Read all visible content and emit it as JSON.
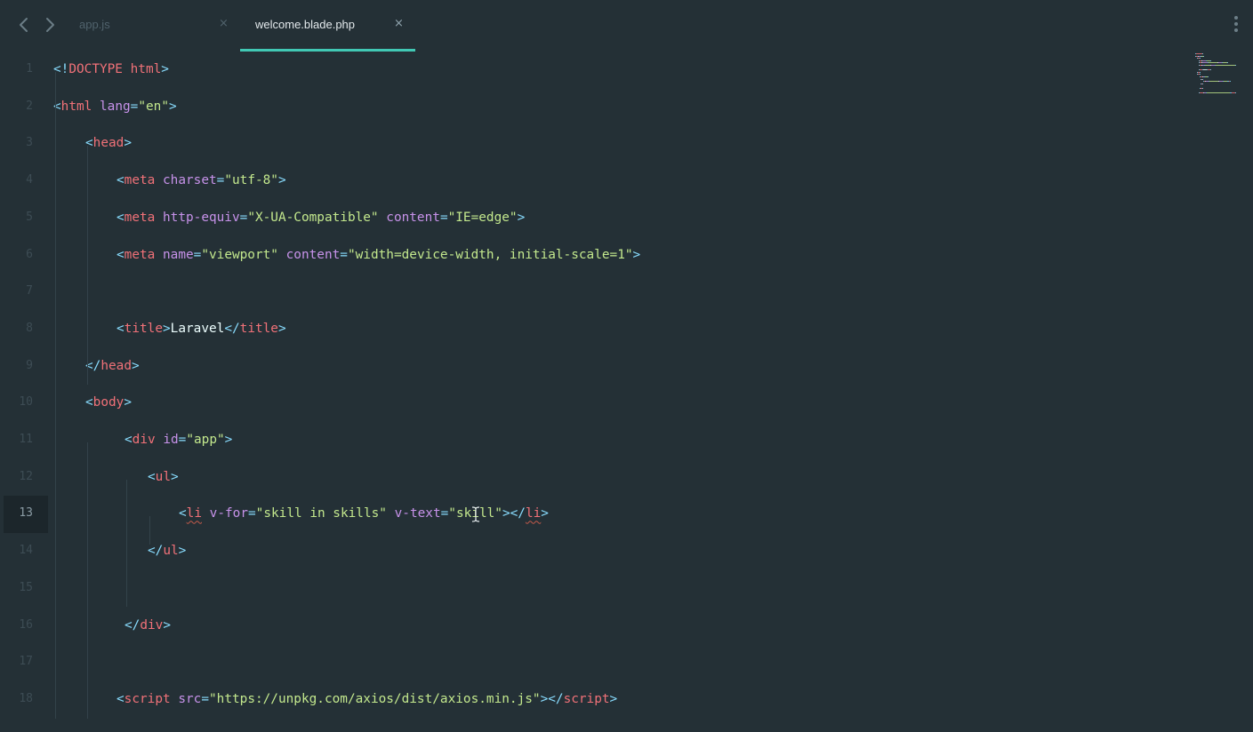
{
  "nav": {
    "back_icon": "chevron-left-icon",
    "forward_icon": "chevron-right-icon"
  },
  "tabs": [
    {
      "label": "app.js",
      "close": "×",
      "active": false
    },
    {
      "label": "welcome.blade.php",
      "close": "×",
      "active": true
    }
  ],
  "menu_icon": "kebab-menu-icon",
  "current_line": 13,
  "colors": {
    "background": "#243036",
    "accent": "#41c8b4",
    "tag": "#f07178",
    "attribute": "#c792ea",
    "string": "#c3e88d",
    "bracket": "#89ddff",
    "text": "#eeffff"
  },
  "lines": [
    {
      "n": "1",
      "tokens": [
        [
          "br",
          "<!"
        ],
        [
          "doc",
          "DOCTYPE html"
        ],
        [
          "br",
          ">"
        ]
      ]
    },
    {
      "n": "2",
      "tokens": [
        [
          "br",
          "<"
        ],
        [
          "tag",
          "html"
        ],
        [
          "txt",
          " "
        ],
        [
          "attr",
          "lang"
        ],
        [
          "br",
          "="
        ],
        [
          "str",
          "\"en\""
        ],
        [
          "br",
          ">"
        ]
      ]
    },
    {
      "n": "3",
      "tokens": [
        [
          "br",
          "<"
        ],
        [
          "tag",
          "head"
        ],
        [
          "br",
          ">"
        ]
      ]
    },
    {
      "n": "4",
      "tokens": [
        [
          "br",
          "<"
        ],
        [
          "tag",
          "meta"
        ],
        [
          "txt",
          " "
        ],
        [
          "attr",
          "charset"
        ],
        [
          "br",
          "="
        ],
        [
          "str",
          "\"utf-8\""
        ],
        [
          "br",
          ">"
        ]
      ]
    },
    {
      "n": "5",
      "tokens": [
        [
          "br",
          "<"
        ],
        [
          "tag",
          "meta"
        ],
        [
          "txt",
          " "
        ],
        [
          "attr",
          "http-equiv"
        ],
        [
          "br",
          "="
        ],
        [
          "str",
          "\"X-UA-Compatible\""
        ],
        [
          "txt",
          " "
        ],
        [
          "attr",
          "content"
        ],
        [
          "br",
          "="
        ],
        [
          "str",
          "\"IE=edge\""
        ],
        [
          "br",
          ">"
        ]
      ]
    },
    {
      "n": "6",
      "tokens": [
        [
          "br",
          "<"
        ],
        [
          "tag",
          "meta"
        ],
        [
          "txt",
          " "
        ],
        [
          "attr",
          "name"
        ],
        [
          "br",
          "="
        ],
        [
          "str",
          "\"viewport\""
        ],
        [
          "txt",
          " "
        ],
        [
          "attr",
          "content"
        ],
        [
          "br",
          "="
        ],
        [
          "str",
          "\"width=device-width, initial-scale=1\""
        ],
        [
          "br",
          ">"
        ]
      ]
    },
    {
      "n": "7",
      "tokens": []
    },
    {
      "n": "8",
      "tokens": [
        [
          "br",
          "<"
        ],
        [
          "tag",
          "title"
        ],
        [
          "br",
          ">"
        ],
        [
          "txt",
          "Laravel"
        ],
        [
          "br",
          "</"
        ],
        [
          "tag",
          "title"
        ],
        [
          "br",
          ">"
        ]
      ]
    },
    {
      "n": "9",
      "tokens": [
        [
          "br",
          "</"
        ],
        [
          "tag",
          "head"
        ],
        [
          "br",
          ">"
        ]
      ]
    },
    {
      "n": "10",
      "tokens": [
        [
          "br",
          "<"
        ],
        [
          "tag",
          "body"
        ],
        [
          "br",
          ">"
        ]
      ]
    },
    {
      "n": "11",
      "tokens": [
        [
          "br",
          "<"
        ],
        [
          "tag",
          "div"
        ],
        [
          "txt",
          " "
        ],
        [
          "attr",
          "id"
        ],
        [
          "br",
          "="
        ],
        [
          "str",
          "\"app\""
        ],
        [
          "br",
          ">"
        ]
      ]
    },
    {
      "n": "12",
      "tokens": [
        [
          "br",
          "<"
        ],
        [
          "tag",
          "ul"
        ],
        [
          "br",
          ">"
        ]
      ]
    },
    {
      "n": "13",
      "tokens": [
        [
          "br",
          "<"
        ],
        [
          "tagsq",
          "li"
        ],
        [
          "txt",
          " "
        ],
        [
          "attr",
          "v-for"
        ],
        [
          "br",
          "="
        ],
        [
          "str",
          "\"skill in skills\""
        ],
        [
          "txt",
          " "
        ],
        [
          "attr",
          "v-text"
        ],
        [
          "br",
          "="
        ],
        [
          "str",
          "\"skill\""
        ],
        [
          "br",
          "></"
        ],
        [
          "tagsq",
          "li"
        ],
        [
          "br",
          ">"
        ]
      ]
    },
    {
      "n": "14",
      "tokens": [
        [
          "br",
          "</"
        ],
        [
          "tag",
          "ul"
        ],
        [
          "br",
          ">"
        ]
      ]
    },
    {
      "n": "15",
      "tokens": []
    },
    {
      "n": "16",
      "tokens": [
        [
          "br",
          "</"
        ],
        [
          "tag",
          "div"
        ],
        [
          "br",
          ">"
        ]
      ]
    },
    {
      "n": "17",
      "tokens": []
    },
    {
      "n": "18",
      "tokens": [
        [
          "br",
          "<"
        ],
        [
          "tag",
          "script"
        ],
        [
          "txt",
          " "
        ],
        [
          "attr",
          "src"
        ],
        [
          "br",
          "="
        ],
        [
          "str",
          "\"https://unpkg.com/axios/dist/axios.min.js\""
        ],
        [
          "br",
          "></"
        ],
        [
          "tag",
          "script"
        ],
        [
          "br",
          ">"
        ]
      ]
    }
  ]
}
